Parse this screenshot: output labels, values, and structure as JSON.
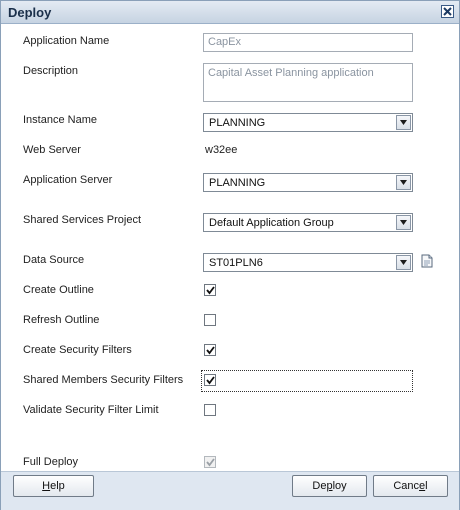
{
  "dialog": {
    "title": "Deploy"
  },
  "fields": {
    "application_name": {
      "label": "Application Name",
      "value": "CapEx"
    },
    "description": {
      "label": "Description",
      "value": "Capital Asset Planning application"
    },
    "instance_name": {
      "label": "Instance Name",
      "value": "PLANNING"
    },
    "web_server": {
      "label": "Web Server",
      "value": "w32ee"
    },
    "application_server": {
      "label": "Application Server",
      "value": "PLANNING"
    },
    "shared_services_project": {
      "label": "Shared Services Project",
      "value": "Default Application Group"
    },
    "data_source": {
      "label": "Data Source",
      "value": "ST01PLN6"
    }
  },
  "options": {
    "create_outline": {
      "label": "Create Outline",
      "checked": true
    },
    "refresh_outline": {
      "label": "Refresh Outline",
      "checked": false
    },
    "create_security_filters": {
      "label": "Create Security Filters",
      "checked": true
    },
    "shared_members_security_filters": {
      "label": "Shared Members Security Filters",
      "checked": true
    },
    "validate_security_filter_limit": {
      "label": "Validate Security Filter Limit",
      "checked": false
    },
    "full_deploy": {
      "label": "Full Deploy",
      "checked": true,
      "disabled": true
    }
  },
  "buttons": {
    "help": {
      "mnemonic": "H",
      "rest": "elp"
    },
    "deploy": {
      "pre": "De",
      "mnemonic": "p",
      "rest": "loy"
    },
    "cancel": {
      "pre": "Canc",
      "mnemonic": "e",
      "rest": "l"
    }
  },
  "icons": {
    "close": "close-icon",
    "data_source_browse": "document-icon",
    "dropdown": "chevron-down-icon",
    "check": "checkmark-icon"
  }
}
